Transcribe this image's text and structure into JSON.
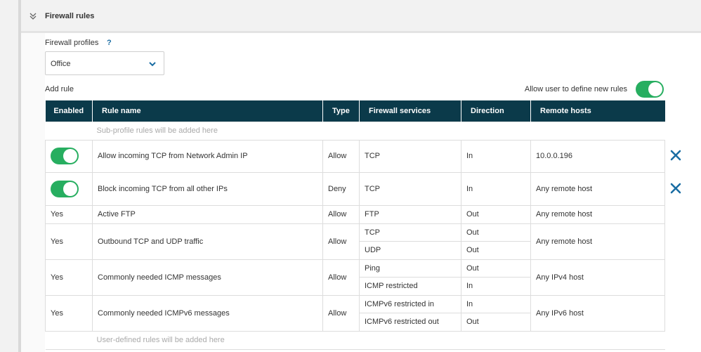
{
  "section": {
    "title": "Firewall rules"
  },
  "profiles": {
    "label": "Firewall profiles",
    "help": "?",
    "selected": "Office"
  },
  "add_rule_label": "Add rule",
  "allow_user_label": "Allow user to define new rules",
  "table": {
    "headers": [
      "Enabled",
      "Rule name",
      "Type",
      "Firewall services",
      "Direction",
      "Remote hosts"
    ],
    "sub_profile_note": "Sub-profile rules will be added here",
    "user_defined_note": "User-defined rules will be added here",
    "rules": [
      {
        "enabled": "toggle-on",
        "name": "Allow incoming TCP from Network Admin IP",
        "type": "Allow",
        "services": [
          {
            "service": "TCP",
            "direction": "In"
          }
        ],
        "remote": "10.0.0.196",
        "removable": true
      },
      {
        "enabled": "toggle-on",
        "name": "Block incoming TCP from all other IPs",
        "type": "Deny",
        "services": [
          {
            "service": "TCP",
            "direction": "In"
          }
        ],
        "remote": "Any remote host",
        "removable": true
      },
      {
        "enabled": "Yes",
        "name": "Active FTP",
        "type": "Allow",
        "services": [
          {
            "service": "FTP",
            "direction": "Out"
          }
        ],
        "remote": "Any remote host"
      },
      {
        "enabled": "Yes",
        "name": "Outbound TCP and UDP traffic",
        "type": "Allow",
        "services": [
          {
            "service": "TCP",
            "direction": "Out"
          },
          {
            "service": "UDP",
            "direction": "Out"
          }
        ],
        "remote": "Any remote host"
      },
      {
        "enabled": "Yes",
        "name": "Commonly needed ICMP messages",
        "type": "Allow",
        "services": [
          {
            "service": "Ping",
            "direction": "Out"
          },
          {
            "service": "ICMP restricted",
            "direction": "In"
          }
        ],
        "remote": "Any IPv4 host"
      },
      {
        "enabled": "Yes",
        "name": "Commonly needed ICMPv6 messages",
        "type": "Allow",
        "services": [
          {
            "service": "ICMPv6 restricted in",
            "direction": "In"
          },
          {
            "service": "ICMPv6 restricted out",
            "direction": "Out"
          }
        ],
        "remote": "Any IPv6 host"
      }
    ]
  },
  "colors": {
    "header_bg": "#0b3a4a",
    "toggle_on": "#27ae60",
    "delete_icon": "#1a6da3"
  }
}
